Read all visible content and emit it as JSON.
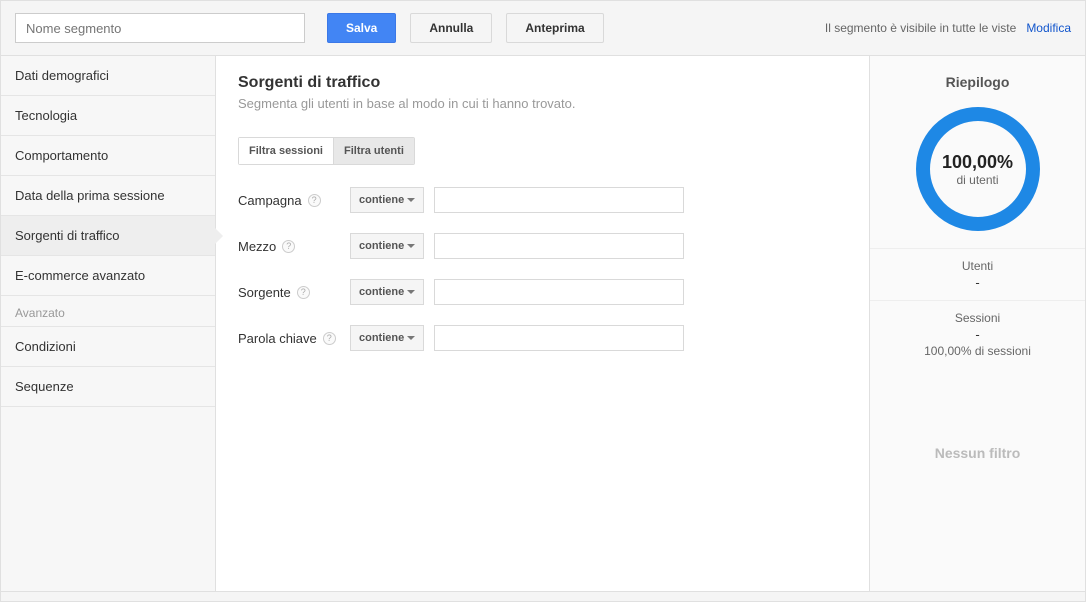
{
  "topbar": {
    "segment_name_placeholder": "Nome segmento",
    "save_label": "Salva",
    "cancel_label": "Annulla",
    "preview_label": "Anteprima",
    "visibility_text": "Il segmento è visibile in tutte le viste",
    "modify_label": "Modifica"
  },
  "sidebar": {
    "items": [
      {
        "label": "Dati demografici"
      },
      {
        "label": "Tecnologia"
      },
      {
        "label": "Comportamento"
      },
      {
        "label": "Data della prima sessione"
      },
      {
        "label": "Sorgenti di traffico"
      },
      {
        "label": "E-commerce avanzato"
      }
    ],
    "advanced_label": "Avanzato",
    "advanced_items": [
      {
        "label": "Condizioni"
      },
      {
        "label": "Sequenze"
      }
    ]
  },
  "main": {
    "title": "Sorgenti di traffico",
    "subtitle": "Segmenta gli utenti in base al modo in cui ti hanno trovato.",
    "filter_tabs": {
      "sessions": "Filtra sessioni",
      "users": "Filtra utenti"
    },
    "fields": [
      {
        "label": "Campagna",
        "operator": "contiene",
        "value": ""
      },
      {
        "label": "Mezzo",
        "operator": "contiene",
        "value": ""
      },
      {
        "label": "Sorgente",
        "operator": "contiene",
        "value": ""
      },
      {
        "label": "Parola chiave",
        "operator": "contiene",
        "value": ""
      }
    ]
  },
  "summary": {
    "title": "Riepilogo",
    "percent": "100,00%",
    "percent_label": "di utenti",
    "users_label": "Utenti",
    "users_value": "-",
    "sessions_label": "Sessioni",
    "sessions_value": "-",
    "sessions_sub": "100,00% di sessioni",
    "no_filter": "Nessun filtro"
  },
  "colors": {
    "primary": "#4285f4",
    "donut": "#1e88e5"
  }
}
